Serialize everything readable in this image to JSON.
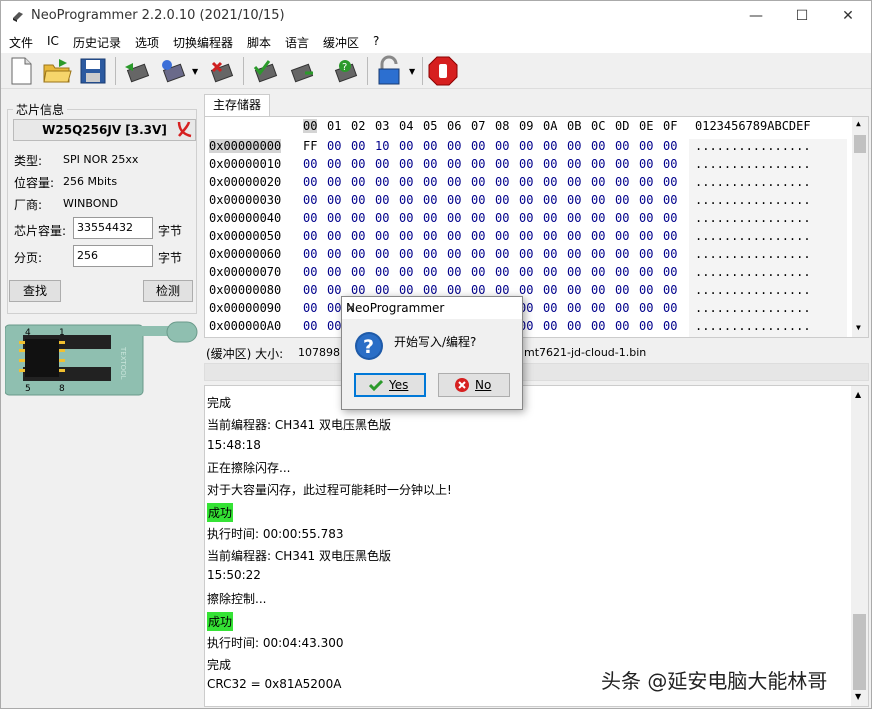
{
  "window": {
    "title": "NeoProgrammer 2.2.0.10 (2021/10/15)",
    "minimize": "—",
    "maximize": "☐",
    "close": "✕"
  },
  "menu": [
    "文件",
    "IC",
    "历史记录",
    "选项",
    "切换编程器",
    "脚本",
    "语言",
    "缓冲区",
    "?"
  ],
  "chip_info": {
    "group_title": "芯片信息",
    "name": "W25Q256JV [3.3V]",
    "type_label": "类型:",
    "type_value": "SPI NOR 25xx",
    "capacity_label": "位容量:",
    "capacity_value": "256 Mbits",
    "vendor_label": "厂商:",
    "vendor_value": "WINBOND",
    "size_label": "芯片容量:",
    "size_value": "33554432",
    "size_unit": "字节",
    "page_label": "分页:",
    "page_value": "256",
    "page_unit": "字节",
    "find_button": "查找",
    "detect_button": "检测",
    "socket_label": "TEXTOOL",
    "pin1": "1",
    "pin4": "4",
    "pin5": "5",
    "pin8": "8"
  },
  "memory_tab": "主存储器",
  "hex": {
    "header_cols": [
      "00",
      "01",
      "02",
      "03",
      "04",
      "05",
      "06",
      "07",
      "08",
      "09",
      "0A",
      "0B",
      "0C",
      "0D",
      "0E",
      "0F"
    ],
    "ascii_header": "0123456789ABCDEF",
    "rows": [
      {
        "addr": "0x00000000",
        "bytes": [
          "FF",
          "00",
          "00",
          "10",
          "00",
          "00",
          "00",
          "00",
          "00",
          "00",
          "00",
          "00",
          "00",
          "00",
          "00",
          "00"
        ],
        "ascii": "................"
      },
      {
        "addr": "0x00000010",
        "bytes": [
          "00",
          "00",
          "00",
          "00",
          "00",
          "00",
          "00",
          "00",
          "00",
          "00",
          "00",
          "00",
          "00",
          "00",
          "00",
          "00"
        ],
        "ascii": "................"
      },
      {
        "addr": "0x00000020",
        "bytes": [
          "00",
          "00",
          "00",
          "00",
          "00",
          "00",
          "00",
          "00",
          "00",
          "00",
          "00",
          "00",
          "00",
          "00",
          "00",
          "00"
        ],
        "ascii": "................"
      },
      {
        "addr": "0x00000030",
        "bytes": [
          "00",
          "00",
          "00",
          "00",
          "00",
          "00",
          "00",
          "00",
          "00",
          "00",
          "00",
          "00",
          "00",
          "00",
          "00",
          "00"
        ],
        "ascii": "................"
      },
      {
        "addr": "0x00000040",
        "bytes": [
          "00",
          "00",
          "00",
          "00",
          "00",
          "00",
          "00",
          "00",
          "00",
          "00",
          "00",
          "00",
          "00",
          "00",
          "00",
          "00"
        ],
        "ascii": "................"
      },
      {
        "addr": "0x00000050",
        "bytes": [
          "00",
          "00",
          "00",
          "00",
          "00",
          "00",
          "00",
          "00",
          "00",
          "00",
          "00",
          "00",
          "00",
          "00",
          "00",
          "00"
        ],
        "ascii": "................"
      },
      {
        "addr": "0x00000060",
        "bytes": [
          "00",
          "00",
          "00",
          "00",
          "00",
          "00",
          "00",
          "00",
          "00",
          "00",
          "00",
          "00",
          "00",
          "00",
          "00",
          "00"
        ],
        "ascii": "................"
      },
      {
        "addr": "0x00000070",
        "bytes": [
          "00",
          "00",
          "00",
          "00",
          "00",
          "00",
          "00",
          "00",
          "00",
          "00",
          "00",
          "00",
          "00",
          "00",
          "00",
          "00"
        ],
        "ascii": "................"
      },
      {
        "addr": "0x00000080",
        "bytes": [
          "00",
          "00",
          "00",
          "00",
          "00",
          "00",
          "00",
          "00",
          "00",
          "00",
          "00",
          "00",
          "00",
          "00",
          "00",
          "00"
        ],
        "ascii": "................"
      },
      {
        "addr": "0x00000090",
        "bytes": [
          "00",
          "00",
          "00",
          "00",
          "00",
          "00",
          "00",
          "00",
          "00",
          "00",
          "00",
          "00",
          "00",
          "00",
          "00",
          "00"
        ],
        "ascii": "................"
      },
      {
        "addr": "0x000000A0",
        "bytes": [
          "00",
          "00",
          "00",
          "00",
          "00",
          "00",
          "00",
          "00",
          "00",
          "00",
          "00",
          "00",
          "00",
          "00",
          "00",
          "00"
        ],
        "ascii": "................"
      }
    ]
  },
  "status": {
    "buffer_label": "(缓冲区) 大小:",
    "buffer_size": "107898",
    "filename": "mt7621-jd-cloud-1.bin"
  },
  "log": [
    {
      "text": "完成",
      "ok": false
    },
    {
      "text": "当前编程器: CH341 双电压黑色版",
      "ok": false
    },
    {
      "text": "15:48:18",
      "ok": false
    },
    {
      "text": "正在擦除闪存...",
      "ok": false
    },
    {
      "text": "对于大容量闪存，此过程可能耗时一分钟以上!",
      "ok": false
    },
    {
      "text": "成功",
      "ok": true
    },
    {
      "text": "执行时间:  00:00:55.783",
      "ok": false
    },
    {
      "text": "当前编程器: CH341 双电压黑色版",
      "ok": false
    },
    {
      "text": "15:50:22",
      "ok": false
    },
    {
      "text": "擦除控制...",
      "ok": false
    },
    {
      "text": "成功",
      "ok": true
    },
    {
      "text": "执行时间:  00:04:43.300",
      "ok": false
    },
    {
      "text": "完成",
      "ok": false
    },
    {
      "text": "CRC32 = 0x81A5200A",
      "ok": false
    }
  ],
  "dialog": {
    "title": "NeoProgrammer",
    "close": "✕",
    "message": "开始写入/编程?",
    "yes": "Yes",
    "no": "No"
  },
  "watermark": "头条 @延安电脑大能林哥",
  "colors": {
    "success_bg": "#35e335",
    "hex_byte": "#00008b",
    "accent_blue": "#1e5aa8"
  }
}
